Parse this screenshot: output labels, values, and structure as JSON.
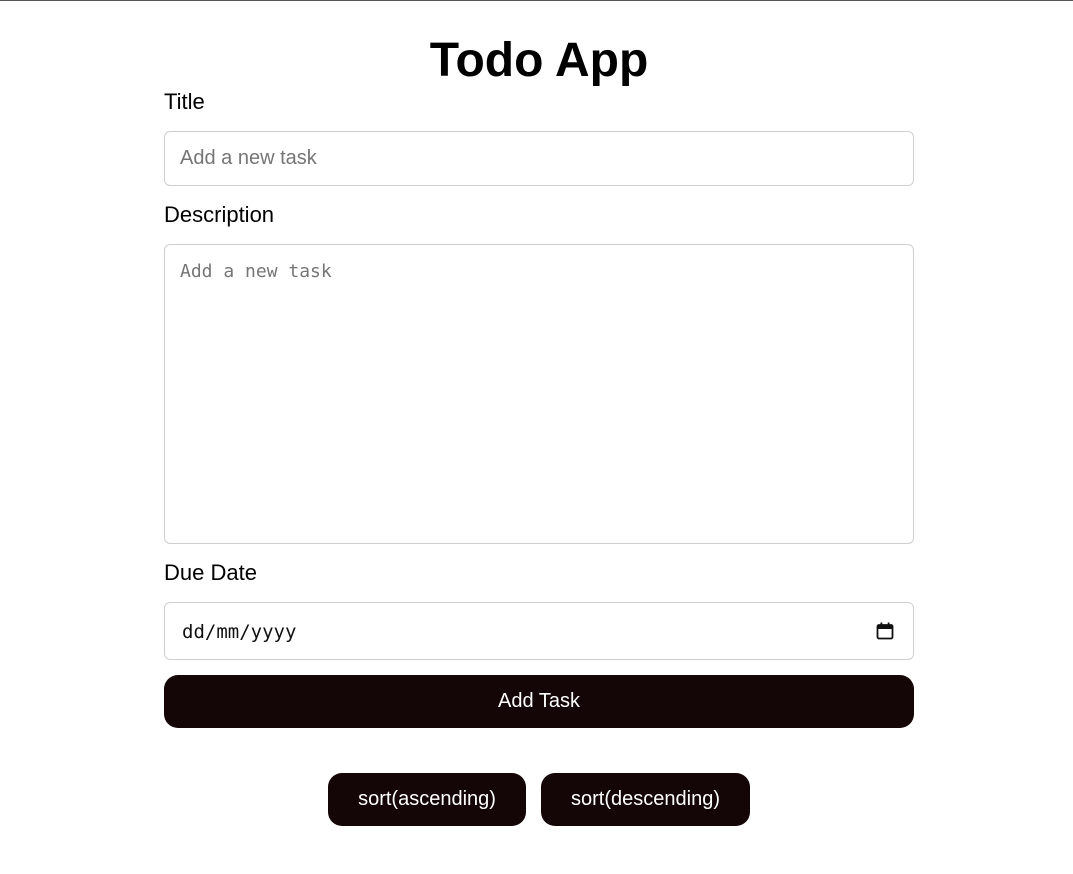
{
  "app": {
    "title": "Todo App"
  },
  "form": {
    "title_label": "Title",
    "title_placeholder": "Add a new task",
    "title_value": "",
    "description_label": "Description",
    "description_placeholder": "Add a new task",
    "description_value": "",
    "due_date_label": "Due Date",
    "due_date_placeholder": "dd/mm/yyyy",
    "due_date_icon": "calendar-icon",
    "add_button_label": "Add Task"
  },
  "sort": {
    "ascending_label": "sort(ascending)",
    "descending_label": "sort(descending)"
  },
  "colors": {
    "button_background": "#140606",
    "button_text": "#ffffff",
    "input_border": "#cfcfcf",
    "placeholder": "#757575"
  }
}
